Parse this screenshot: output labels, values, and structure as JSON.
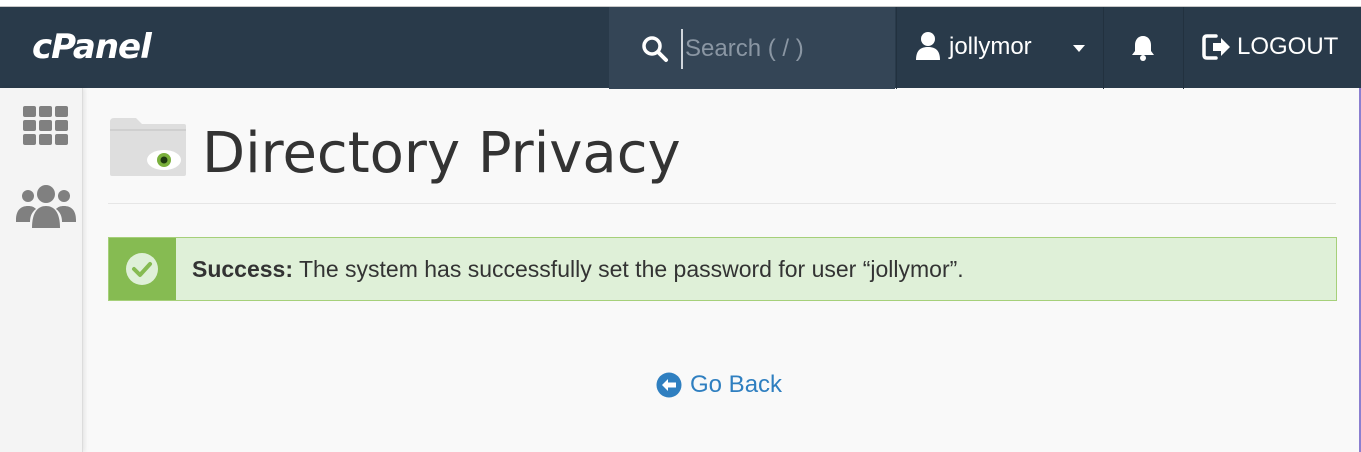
{
  "header": {
    "logo_text": "cPanel",
    "search_placeholder": "Search ( / )",
    "username": "jollymor",
    "logout_label": "LOGOUT"
  },
  "sidebar": {
    "items": [
      {
        "icon": "grid-icon"
      },
      {
        "icon": "users-icon"
      }
    ]
  },
  "main": {
    "page_title": "Directory Privacy",
    "alert": {
      "label": "Success:",
      "message": "The system has successfully set the password for user “jollymor”."
    },
    "go_back_label": "Go Back"
  },
  "colors": {
    "navbar": "#293a4a",
    "success_accent": "#86bb52",
    "success_bg": "#dff0d8",
    "link": "#2f7fc0"
  }
}
